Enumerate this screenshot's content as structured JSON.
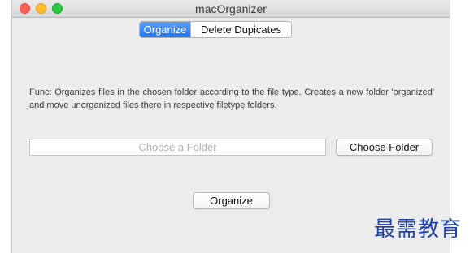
{
  "window": {
    "title": "macOrganizer"
  },
  "tabs": [
    {
      "label": "Organize",
      "selected": true
    },
    {
      "label": "Delete Dupicates",
      "selected": false
    }
  ],
  "main": {
    "description": "Func: Organizes files in the chosen folder according to the file type. Creates a new folder 'organized' and move unorganized files there in respective filetype folders.",
    "folder_placeholder": "Choose a Folder",
    "folder_value": "",
    "choose_button_label": "Choose Folder",
    "organize_button_label": "Organize"
  },
  "watermark": {
    "text": "最需教育"
  },
  "colors": {
    "accent": "#1e74f0",
    "close": "#fc5f57",
    "minimize": "#fdbc2e",
    "maximize": "#28c840",
    "watermark": "#1f3fa8"
  }
}
